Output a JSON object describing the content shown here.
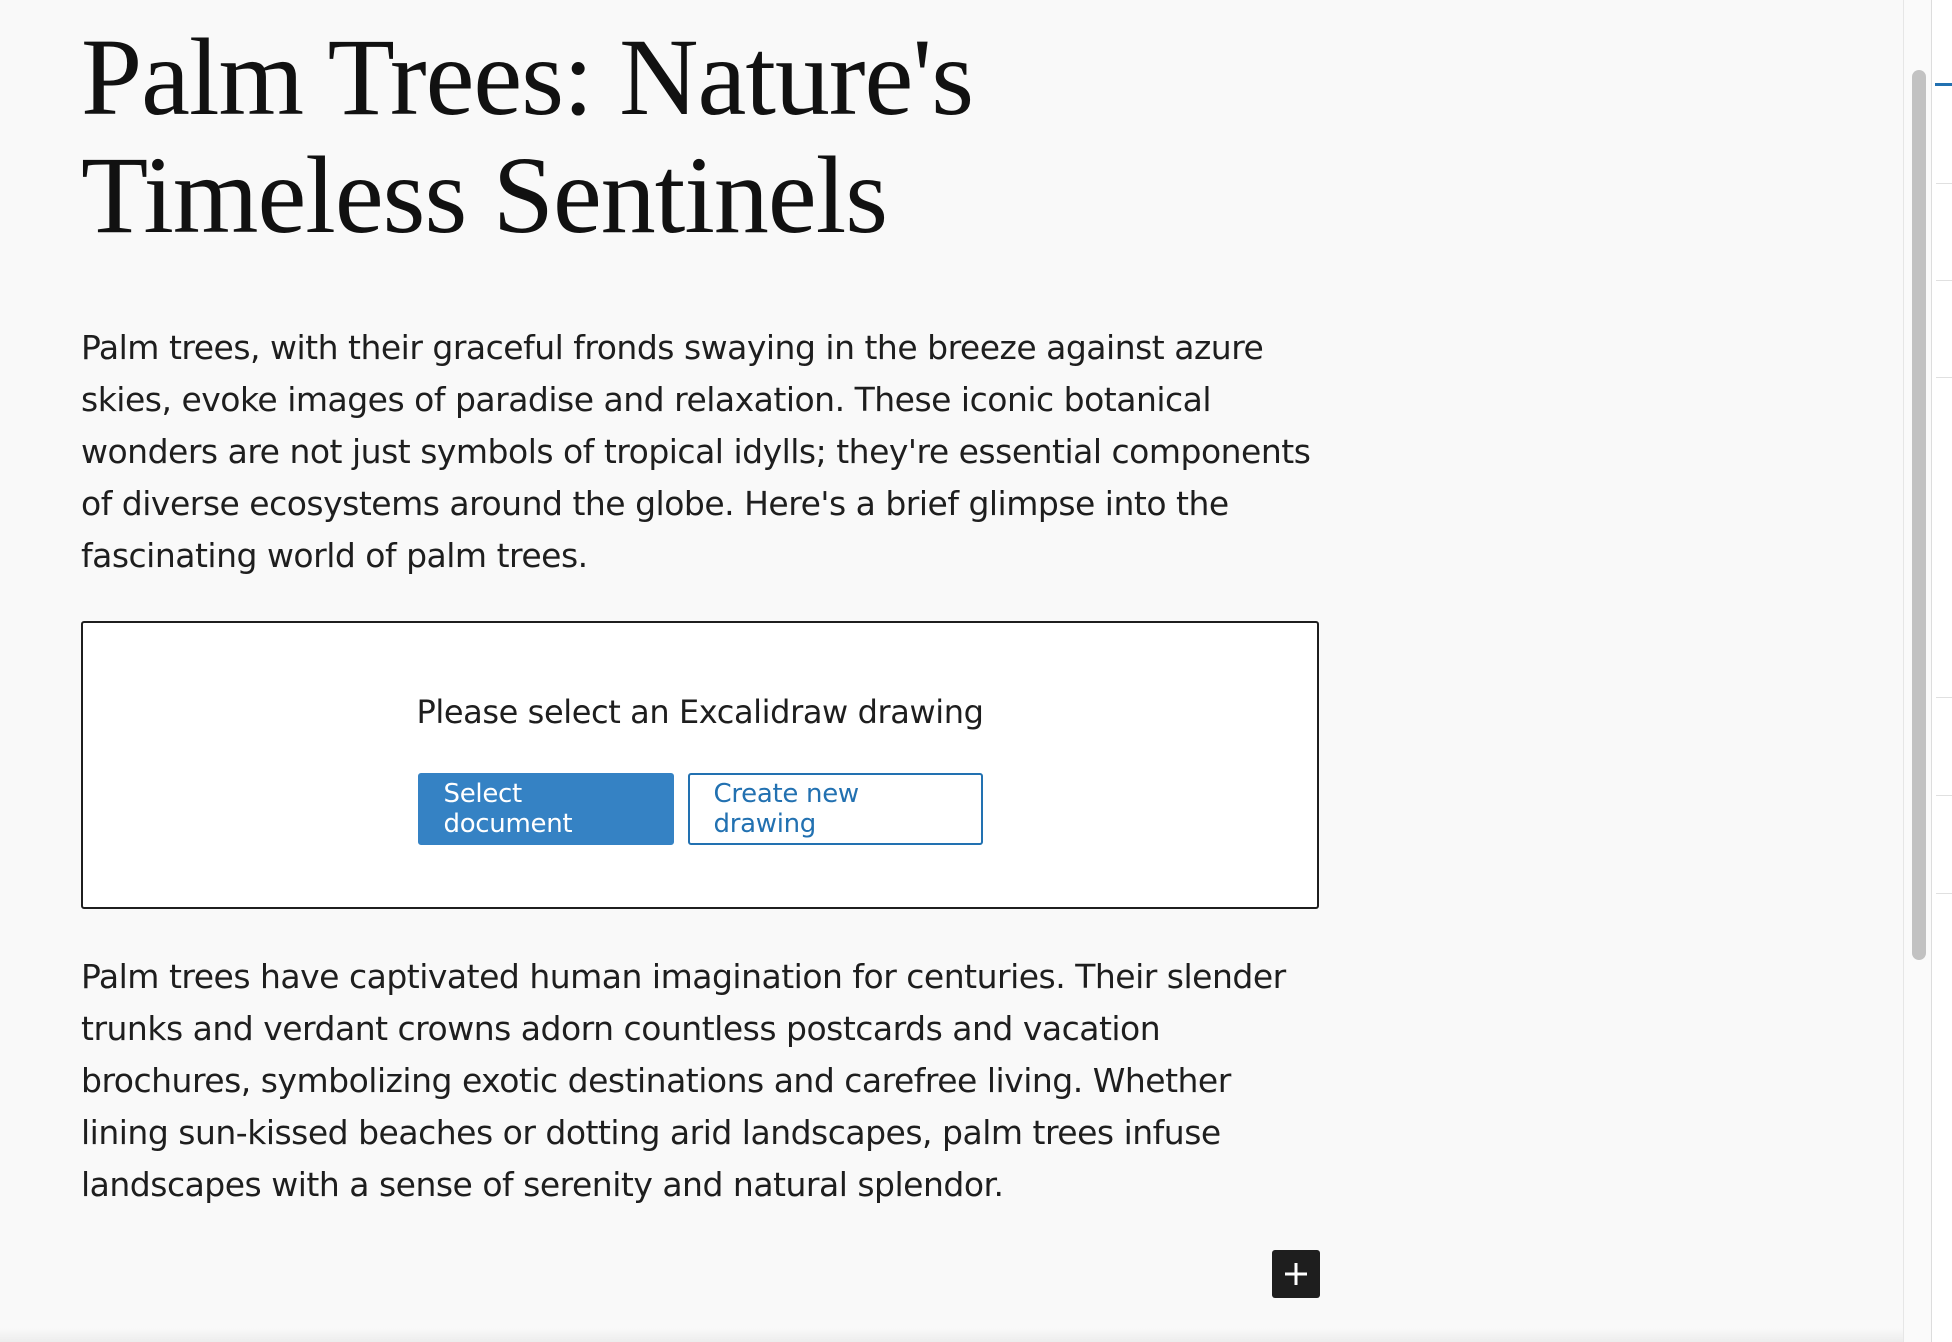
{
  "post": {
    "title": "Palm Trees: Nature's Timeless Sentinels",
    "paragraphs": [
      "Palm trees, with their graceful fronds swaying in the breeze against azure skies, evoke images of paradise and relaxation. These iconic botanical wonders are not just symbols of tropical idylls; they're essential components of diverse ecosystems around the globe. Here's a brief glimpse into the fascinating world of palm trees.",
      "Palm trees have captivated human imagination for centuries. Their slender trunks and verdant crowns adorn countless postcards and vacation brochures, symbolizing exotic destinations and carefree living. Whether lining sun-kissed beaches or dotting arid landscapes, palm trees infuse landscapes with a sense of serenity and natural splendor."
    ]
  },
  "excalidraw_block": {
    "prompt": "Please select an Excalidraw drawing",
    "select_label": "Select document",
    "create_label": "Create new drawing"
  },
  "inserter": {
    "icon": "plus-icon"
  },
  "colors": {
    "primary_button": "#3582c4",
    "secondary_button_text": "#2271b1",
    "canvas_background": "#f9f9f9",
    "text": "#1e1e1e"
  }
}
